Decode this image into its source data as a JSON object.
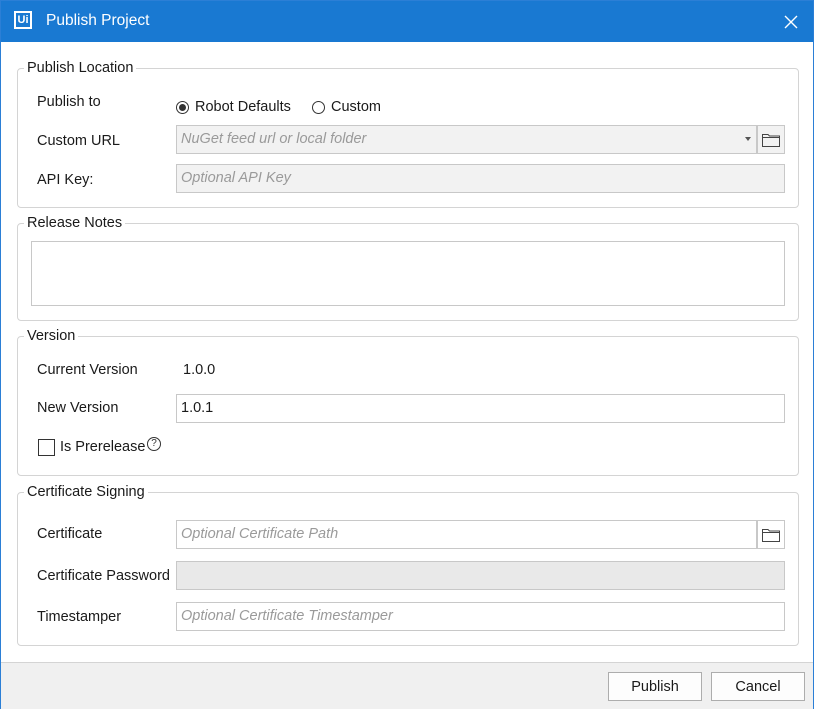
{
  "window": {
    "title": "Publish Project",
    "app_icon_text": "Ui"
  },
  "publish_location": {
    "legend": "Publish Location",
    "publish_to_label": "Publish to",
    "options": [
      {
        "label": "Robot Defaults",
        "selected": true
      },
      {
        "label": "Custom",
        "selected": false
      }
    ],
    "custom_url_label": "Custom URL",
    "custom_url_placeholder": "NuGet feed url or local folder",
    "api_key_label": "API Key:",
    "api_key_placeholder": "Optional API Key"
  },
  "release_notes": {
    "legend": "Release Notes",
    "value": ""
  },
  "version": {
    "legend": "Version",
    "current_label": "Current Version",
    "current_value": "1.0.0",
    "new_label": "New Version",
    "new_value": "1.0.1",
    "prerelease_label": "Is Prerelease",
    "prerelease_checked": false,
    "help_glyph": "?"
  },
  "certificate_signing": {
    "legend": "Certificate Signing",
    "certificate_label": "Certificate",
    "certificate_placeholder": "Optional Certificate Path",
    "password_label": "Certificate Password",
    "timestamper_label": "Timestamper",
    "timestamper_placeholder": "Optional Certificate Timestamper"
  },
  "footer": {
    "publish_label": "Publish",
    "cancel_label": "Cancel"
  },
  "colors": {
    "titlebar": "#1979d2",
    "window_bg": "#f0f0f0",
    "field_disabled_bg": "#f2f2f2"
  }
}
